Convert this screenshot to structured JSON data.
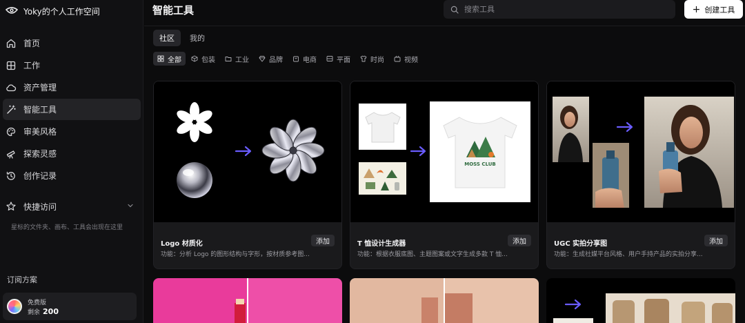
{
  "app": {
    "workspace_name": "Yoky的个人工作空间"
  },
  "sidebar": {
    "items": [
      {
        "label": "首页",
        "icon": "home-icon"
      },
      {
        "label": "工作",
        "icon": "grid-icon"
      },
      {
        "label": "资产管理",
        "icon": "cloud-icon"
      },
      {
        "label": "智能工具",
        "icon": "magic-wand-icon",
        "active": true
      },
      {
        "label": "审美风格",
        "icon": "palette-icon"
      },
      {
        "label": "探索灵感",
        "icon": "telescope-icon"
      },
      {
        "label": "创作记录",
        "icon": "history-icon"
      }
    ],
    "quick_access": {
      "label": "快捷访问",
      "hint": "星标的文件夹、画布、工具会出现在这里"
    },
    "subscription": {
      "title": "订阅方案",
      "plan_name": "免费版",
      "remain_label": "剩余",
      "remain_value": "200"
    }
  },
  "header": {
    "title": "智能工具",
    "search_placeholder": "搜索工具",
    "create_label": "创建工具"
  },
  "tabs": [
    {
      "label": "社区",
      "active": true
    },
    {
      "label": "我的",
      "active": false
    }
  ],
  "filters": [
    {
      "label": "全部",
      "icon": "grid-icon",
      "active": true
    },
    {
      "label": "包装",
      "icon": "box-icon"
    },
    {
      "label": "工业",
      "icon": "folder-icon"
    },
    {
      "label": "品牌",
      "icon": "diamond-icon"
    },
    {
      "label": "电商",
      "icon": "shop-icon"
    },
    {
      "label": "平面",
      "icon": "layout-icon"
    },
    {
      "label": "时尚",
      "icon": "shirt-icon"
    },
    {
      "label": "视频",
      "icon": "video-icon"
    }
  ],
  "cards": [
    {
      "name": "Logo 材质化",
      "desc": "功能：分析 Logo 的图形结构与字形，按材质参考图...",
      "add_label": "添加"
    },
    {
      "name": "T 恤设计生成器",
      "desc": "功能：根据衣服底图、主题图案或文字生成多款 T 恤...",
      "add_label": "添加",
      "shirt_text": "MOSS CLUB"
    },
    {
      "name": "UGC 实拍分享图",
      "desc": "功能：生成社媒平台风格、用户手持产品的实拍分享...",
      "add_label": "添加"
    }
  ],
  "colors": {
    "accent_arrow": "#6a5cff",
    "background": "#0c0c0d",
    "card": "#1a1a1c"
  }
}
